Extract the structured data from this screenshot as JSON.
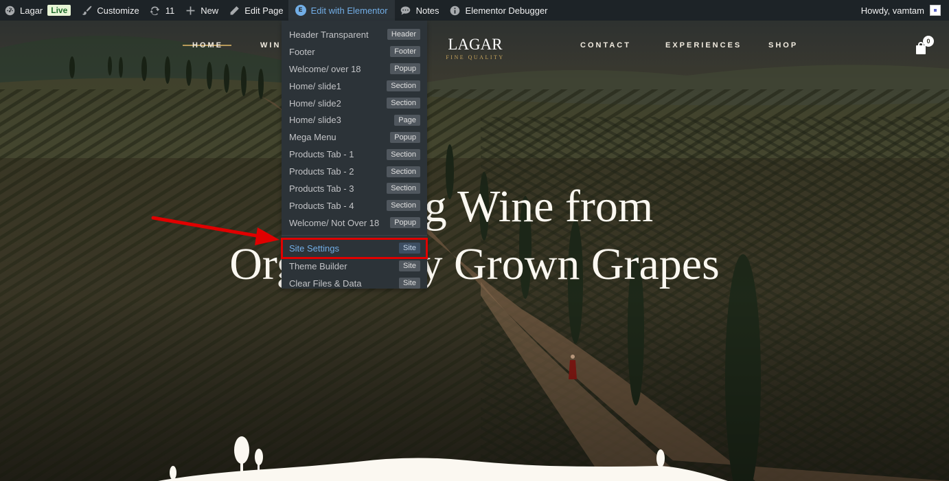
{
  "adminbar": {
    "site_name": "Lagar",
    "live_badge": "Live",
    "customize": "Customize",
    "updates_count": "11",
    "new": "New",
    "edit_page": "Edit Page",
    "edit_elementor": "Edit with Elementor",
    "notes": "Notes",
    "debugger": "Elementor Debugger",
    "howdy": "Howdy, vamtam"
  },
  "nav": {
    "home": "HOME",
    "wines": "WIN",
    "contact": "CONTACT",
    "experiences": "EXPERIENCES",
    "shop": "SHOP",
    "logo_main": "LAGAR",
    "logo_sub": "FINE QUALITY",
    "cart_count": "0"
  },
  "hero": {
    "line_1": "Crafting Wine from",
    "line_2": "Organically Grown Grapes"
  },
  "dropdown": {
    "items": [
      {
        "label": "Header Transparent",
        "badge": "Header"
      },
      {
        "label": "Footer",
        "badge": "Footer"
      },
      {
        "label": "Welcome/ over 18",
        "badge": "Popup"
      },
      {
        "label": "Home/ slide1",
        "badge": "Section"
      },
      {
        "label": "Home/ slide2",
        "badge": "Section"
      },
      {
        "label": "Home/ slide3",
        "badge": "Page"
      },
      {
        "label": "Mega Menu",
        "badge": "Popup"
      },
      {
        "label": "Products Tab - 1",
        "badge": "Section"
      },
      {
        "label": "Products Tab - 2",
        "badge": "Section"
      },
      {
        "label": "Products Tab - 3",
        "badge": "Section"
      },
      {
        "label": "Products Tab - 4",
        "badge": "Section"
      },
      {
        "label": "Welcome/ Not Over 18",
        "badge": "Popup"
      }
    ],
    "site_items": [
      {
        "label": "Site Settings",
        "badge": "Site"
      },
      {
        "label": "Theme Builder",
        "badge": "Site"
      },
      {
        "label": "Clear Files & Data",
        "badge": "Site"
      }
    ]
  },
  "colors": {
    "adminbar_bg": "#1d2327",
    "dropdown_bg": "#2c3338",
    "elementor_blue": "#72aee6",
    "highlight_red": "#e00000",
    "logo_gold": "#c6a45d"
  }
}
